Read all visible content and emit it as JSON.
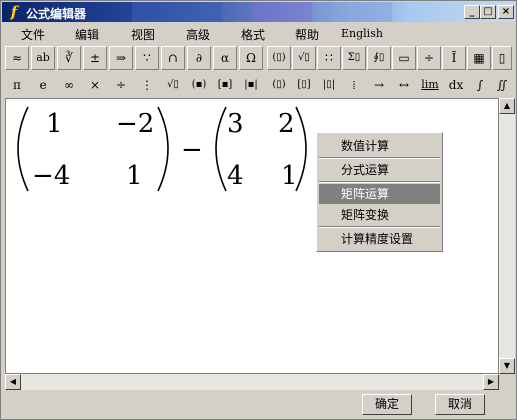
{
  "window": {
    "title": "公式编辑器",
    "app_icon": "f-icon"
  },
  "menu": [
    "文件",
    "编辑",
    "视图",
    "高级",
    "格式",
    "帮助",
    "English"
  ],
  "toolbar1": [
    "≈",
    "ab",
    "∛",
    "±",
    "⇒",
    "∵",
    "∩",
    "∂",
    "α",
    "Ω",
    "(▯)",
    "√▯",
    "∷",
    "Σ▯",
    "∮▯",
    "▭",
    "÷",
    "Ī",
    "▦",
    "▯"
  ],
  "toolbar2": [
    "π",
    "e",
    "∞",
    "×",
    "÷",
    "⋮",
    "√▯",
    "(▪)",
    "[▪]",
    "|▪|",
    "(▯)",
    "[▯]",
    "|▯|",
    "⁞",
    "→",
    "↔",
    "lim",
    "dx",
    "∫",
    "∬"
  ],
  "matrix_a": {
    "values": [
      "1",
      "−2",
      "−4",
      "1"
    ]
  },
  "operator": "−",
  "matrix_b": {
    "values": [
      "3",
      "2",
      "4",
      "1"
    ]
  },
  "context_menu": {
    "items": [
      "数值计算",
      "分式运算",
      "矩阵运算",
      "矩阵变换",
      "计算精度设置"
    ],
    "highlighted": "矩阵运算"
  },
  "buttons": {
    "ok": "确定",
    "cancel": "取消"
  },
  "colors": {
    "title_start": "#0a246a",
    "title_end": "#a6caf0",
    "highlight": "#808080",
    "face": "#d4d0c8"
  }
}
